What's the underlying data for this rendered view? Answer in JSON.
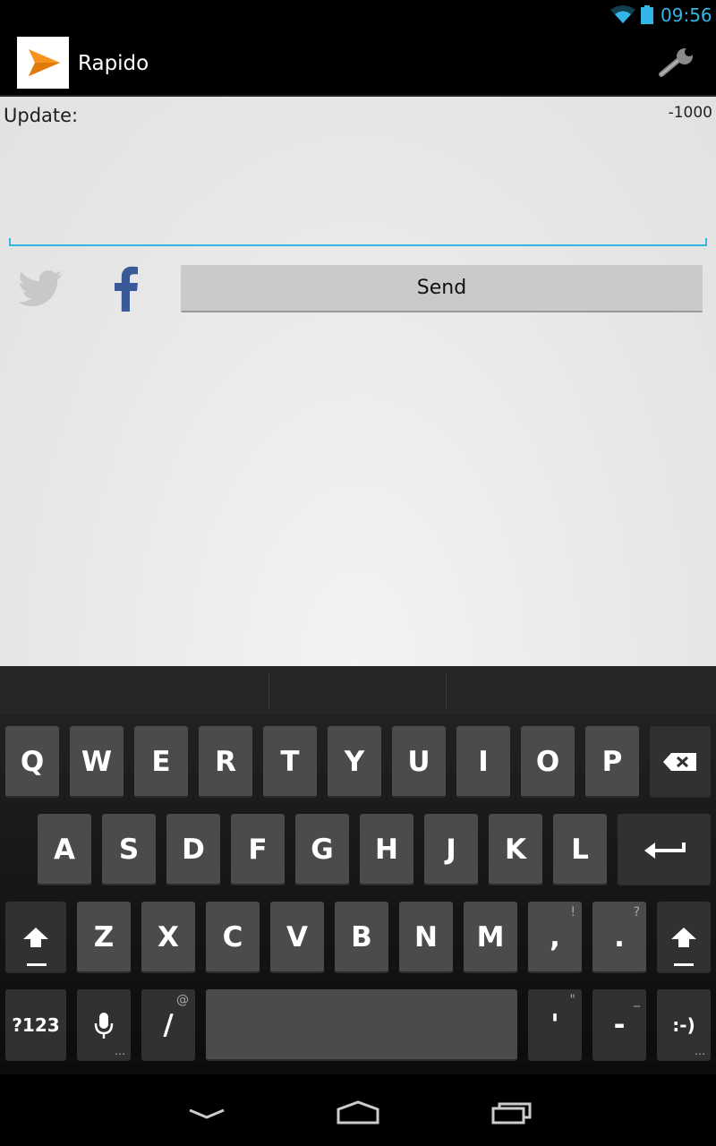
{
  "status_bar": {
    "time": "09:56",
    "accent": "#33b5e5"
  },
  "action_bar": {
    "title": "Rapido",
    "icon": "paper-plane-icon",
    "settings_icon": "wrench-icon"
  },
  "composer": {
    "label": "Update:",
    "char_count": "-1000",
    "value": "",
    "twitter_icon": "twitter-icon",
    "twitter_enabled": false,
    "facebook_icon": "facebook-icon",
    "facebook_enabled": true,
    "send_label": "Send"
  },
  "keyboard": {
    "row1": [
      "Q",
      "W",
      "E",
      "R",
      "T",
      "Y",
      "U",
      "I",
      "O",
      "P"
    ],
    "row2": [
      "A",
      "S",
      "D",
      "F",
      "G",
      "H",
      "J",
      "K",
      "L"
    ],
    "row3": [
      "Z",
      "X",
      "C",
      "V",
      "B",
      "N",
      "M"
    ],
    "comma": {
      "label": ",",
      "hint": "!"
    },
    "period": {
      "label": ".",
      "hint": "?"
    },
    "symbols_label": "?123",
    "slash": {
      "label": "/",
      "hint": "@"
    },
    "apostrophe": {
      "label": "'",
      "hint": "\""
    },
    "dash": {
      "label": "-",
      "hint": "_"
    },
    "emoticon_label": ":-)"
  },
  "nav_bar": [
    "back-icon",
    "home-icon",
    "recents-icon"
  ]
}
